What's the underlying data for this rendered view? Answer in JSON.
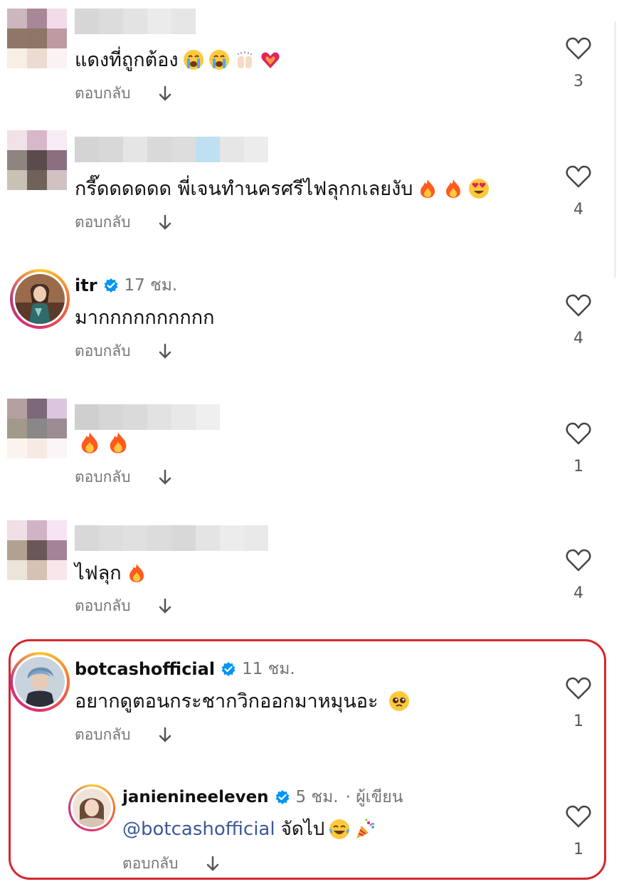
{
  "comments": [
    {
      "text": "แดงที่ถูกต้อง",
      "reply_label": "ตอบกลับ",
      "likes": "3",
      "emojis": [
        "crying-face",
        "crying-face",
        "raising-hands",
        "heart-on-fire"
      ]
    },
    {
      "text": "กรี๊ดดดดดด พี่เจนทำนครศรีไฟลุกกเลยงับ",
      "reply_label": "ตอบกลับ",
      "likes": "4",
      "emojis": [
        "fire",
        "fire",
        "heart-eyes"
      ]
    },
    {
      "username": "itr",
      "time": "17 ชม.",
      "text": "มากกกกกกกกกก",
      "reply_label": "ตอบกลับ",
      "likes": "4"
    },
    {
      "text": "",
      "reply_label": "ตอบกลับ",
      "likes": "1",
      "emojis": [
        "fire",
        "fire"
      ]
    },
    {
      "text": "ไฟลุก",
      "reply_label": "ตอบกลับ",
      "likes": "4",
      "emojis": [
        "fire"
      ]
    },
    {
      "username": "botcashofficial",
      "time": "11 ชม.",
      "text": "อยากดูตอนกระชากวิกออกมาหมุนอะ",
      "reply_label": "ตอบกลับ",
      "likes": "1",
      "emojis": [
        "pleading-face"
      ]
    }
  ],
  "reply": {
    "username": "janienineeleven",
    "time": "5 ชม.",
    "author_tag": "· ผู้เขียน",
    "mention": "@botcashofficial",
    "text": "จัดไป",
    "reply_label": "ตอบกลับ",
    "likes": "1",
    "emojis": [
      "tears-of-joy",
      "party-popper"
    ]
  },
  "colors": {
    "highlight_border": "#d6262e",
    "verified": "#0095f6",
    "secondary_text": "#737373",
    "mention": "#3b5998"
  }
}
